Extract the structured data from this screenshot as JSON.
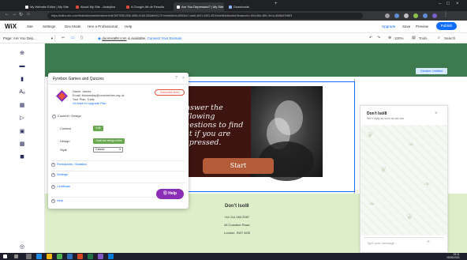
{
  "browser": {
    "tabs": [
      {
        "label": "My Website Editor | My Site"
      },
      {
        "label": "About My Site - Analytics"
      },
      {
        "label": "A Google Aft de Results"
      },
      {
        "label": "Are You Depressed? | My Site"
      },
      {
        "label": "Downloads"
      }
    ],
    "url": "https://editor.wix.com/html/editor/web/renderer/edit/1f5793f5-0f36-4880-9168-253d6e9117f?metaSiteId=89304a7-cab6-4b01-9402-4819d4e8b5d&editorSessionId=1f9d-6bb-48f1-9e1d-d5d8c57b8ff3"
  },
  "wix": {
    "logo": "WiX",
    "menu": [
      "Site",
      "Settings",
      "Dev Mode",
      "Hire a Professional",
      "Help"
    ],
    "right_actions": {
      "upgrade": "Upgrade",
      "save": "Save",
      "preview": "Preview",
      "publish": "Publish"
    },
    "page_selector": "Page: Are You Dep...",
    "domain_url": "doomisall8.com",
    "domain_status": " is available.",
    "domain_link": "Connect Your Domain",
    "zoom": "100%",
    "tools": "Tools",
    "search": "Search"
  },
  "canvas": {
    "header_badge": "Section: Untitled",
    "hero_text": "Answer the following questions to find out if you are depressed.",
    "start_button": "Start",
    "footer": {
      "title": "Don't Isol8",
      "phone": "+44 114 283 2087",
      "address1": "28 Crowther Road",
      "address2": "London, SW7 8GE"
    }
  },
  "chat": {
    "title": "Don't Isol8",
    "subtitle": "We'll reply as soon as we can",
    "placeholder": "Type your message..."
  },
  "panel": {
    "title": "Fyrebox Games and Quizzes",
    "name": "Name: James",
    "email": "Email: fdoomsday@crowherfam.org.uk",
    "plan": "Your Plan: Trials",
    "upgrade_link": "Go back to Upgrade Plan",
    "subscribe": "Subscribe Here",
    "content_design": "Content / Design",
    "content_label": "Content",
    "edit_button": "Edit",
    "design_label": "Design",
    "design_button": "Open the design editor",
    "style_label": "Style",
    "style_value": "Classic",
    "sections": [
      "Participants / Statistics",
      "Settings",
      "Certificate",
      "Help"
    ],
    "help_button": "Help"
  },
  "taskbar": {
    "time": "09:11",
    "date": "25/05/2020"
  }
}
